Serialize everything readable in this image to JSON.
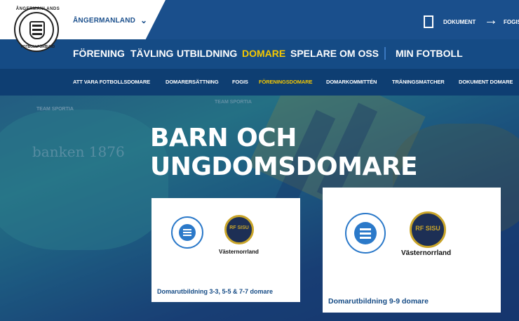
{
  "header": {
    "region_label": "ÅNGERMANLAND",
    "region_chevron": "⌄",
    "logo_text_top": "ÅNGERMANLANDS",
    "logo_text_bottom": "FOTBOLLFÖRBUND",
    "documents_label": "DOKUMENT",
    "fogis_label": "FOGIS"
  },
  "main_nav": [
    {
      "label": "FÖRENING",
      "active": false
    },
    {
      "label": "TÄVLING",
      "active": false
    },
    {
      "label": "UTBILDNING",
      "active": false
    },
    {
      "label": "DOMARE",
      "active": true
    },
    {
      "label": "SPELARE",
      "active": false
    },
    {
      "label": "OM OSS",
      "active": false
    },
    {
      "label": "MIN FOTBOLL",
      "active": false
    }
  ],
  "sub_nav": [
    {
      "label": "ATT VARA FOTBOLLSDOMARE",
      "active": false
    },
    {
      "label": "DOMARERSÄTTNING",
      "active": false
    },
    {
      "label": "FOGIS",
      "active": false
    },
    {
      "label": "FÖRENINGSDOMARE",
      "active": true
    },
    {
      "label": "DOMARKOMMITTÉN",
      "active": false
    },
    {
      "label": "TRÄNINGSMATCHER",
      "active": false
    },
    {
      "label": "DOKUMENT DOMARE",
      "active": false
    }
  ],
  "hero": {
    "title": "BARN OCH UNGDOMSDOMARE",
    "bg_text_1": "banken 1876",
    "bg_text_2": "TEAM SPORTIA",
    "bg_text_3": "TEAM SPORTIA"
  },
  "cards": [
    {
      "title": "Domarutbildning 3-3, 5-5 & 7-7 domare",
      "partner": "Västernorrland",
      "sisu_text": "RF SISU"
    },
    {
      "title": "Domarutbildning 9-9 domare",
      "partner": "Västernorrland",
      "sisu_text": "RF SISU"
    }
  ],
  "colors": {
    "brand_blue": "#1a4f8c",
    "nav_dark": "#0e3e72",
    "active_yellow": "#f5c800"
  }
}
